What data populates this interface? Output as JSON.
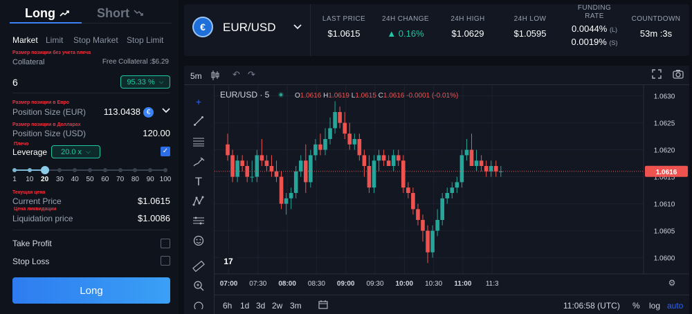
{
  "side_tabs": {
    "long": "Long",
    "short": "Short"
  },
  "order_tabs": [
    "Market",
    "Limit",
    "Stop Market",
    "Stop Limit"
  ],
  "order_tabs_active": 0,
  "collateral": {
    "ru_hint": "Размер позиции без учета плеча",
    "label": "Collateral",
    "free_label": "Free Collateral :$6.29",
    "amount": "6",
    "percent": "95.33 %"
  },
  "position_eur": {
    "ru_hint": "Размер позиции в Евро",
    "label": "Position Size (EUR)",
    "value": "113.0438"
  },
  "position_usd": {
    "ru_hint": "Размер позиции в Долларах",
    "label": "Position Size (USD)",
    "value": "120.00"
  },
  "leverage": {
    "ru_hint": "Плечо",
    "label": "Leverage",
    "value": "20.0 x",
    "checked": true,
    "marks": [
      "1",
      "10",
      "20",
      "30",
      "40",
      "50",
      "60",
      "70",
      "80",
      "90",
      "100"
    ],
    "current_mark_index": 2
  },
  "current_price": {
    "ru_hint": "Текущая цена",
    "label": "Current Price",
    "value": "$1.0615"
  },
  "liquidation": {
    "ru_hint": "Цена ликвидации",
    "label": "Liquidation price",
    "value": "$1.0086"
  },
  "take_profit": {
    "label": "Take Profit"
  },
  "stop_loss": {
    "label": "Stop Loss"
  },
  "submit_label": "Long",
  "market": {
    "pair_base": "EUR",
    "pair_quote": "/USD",
    "stats": [
      {
        "label": "LAST PRICE",
        "value": "$1.0615"
      },
      {
        "label": "24H CHANGE",
        "value": "▲ 0.16%"
      },
      {
        "label": "24H HIGH",
        "value": "$1.0629"
      },
      {
        "label": "24H LOW",
        "value": "$1.0595"
      },
      {
        "label": "FUNDING",
        "label2": "RATE",
        "value": "0.0044%",
        "value_tag": "(L)",
        "value2": "0.0019%",
        "value2_tag": "(S)"
      },
      {
        "label": "COUNTDOWN",
        "value": "53m :3s"
      }
    ]
  },
  "chart_toolbar": {
    "timeframe": "5m"
  },
  "chart_bottom": {
    "ranges": [
      "6h",
      "1d",
      "3d",
      "2w",
      "3m"
    ],
    "clock": "11:06:58 (UTC)",
    "pct": "%",
    "log": "log",
    "auto": "auto"
  },
  "chart_data": {
    "type": "candlestick",
    "symbol": "EUR/USD · 5",
    "legend": {
      "o": "1.0616",
      "h": "1.0619",
      "l": "1.0615",
      "c": "1.0616",
      "change": "-0.0001 (-0.01%)"
    },
    "last_price_label": "1.0616",
    "ylim": [
      1.0597,
      1.0632
    ],
    "y_ticks": [
      "1.0630",
      "1.0625",
      "1.0620",
      "1.0615",
      "1.0610",
      "1.0605",
      "1.0600"
    ],
    "x_ticks": [
      "07:00",
      "07:30",
      "08:00",
      "08:30",
      "09:00",
      "09:30",
      "10:00",
      "10:30",
      "11:00",
      "11:3"
    ],
    "up_color": "#26a69a",
    "down_color": "#ef5350",
    "candles": [
      [
        1.0621,
        1.0623,
        1.0618,
        1.0619
      ],
      [
        1.0619,
        1.062,
        1.0614,
        1.0615
      ],
      [
        1.0615,
        1.0619,
        1.0614,
        1.0618
      ],
      [
        1.0618,
        1.0619,
        1.0616,
        1.0617
      ],
      [
        1.0617,
        1.0618,
        1.0614,
        1.0615
      ],
      [
        1.0615,
        1.0618,
        1.0614,
        1.0615
      ],
      [
        1.0615,
        1.062,
        1.0614,
        1.0619
      ],
      [
        1.0619,
        1.0622,
        1.0617,
        1.0618
      ],
      [
        1.0618,
        1.0619,
        1.0616,
        1.0617
      ],
      [
        1.0617,
        1.0619,
        1.0615,
        1.0616
      ],
      [
        1.0616,
        1.0618,
        1.0614,
        1.0615
      ],
      [
        1.0615,
        1.0616,
        1.0609,
        1.061
      ],
      [
        1.061,
        1.0612,
        1.0608,
        1.0611
      ],
      [
        1.0611,
        1.0613,
        1.0609,
        1.0612
      ],
      [
        1.0612,
        1.0617,
        1.0611,
        1.0616
      ],
      [
        1.0616,
        1.0619,
        1.0615,
        1.0618
      ],
      [
        1.0618,
        1.0621,
        1.0612,
        1.0614
      ],
      [
        1.0614,
        1.062,
        1.0613,
        1.0619
      ],
      [
        1.0619,
        1.0622,
        1.0618,
        1.0621
      ],
      [
        1.0621,
        1.0623,
        1.0619,
        1.062
      ],
      [
        1.062,
        1.0624,
        1.0619,
        1.0622
      ],
      [
        1.0622,
        1.0626,
        1.0621,
        1.0624
      ],
      [
        1.0624,
        1.0629,
        1.0623,
        1.0627
      ],
      [
        1.0627,
        1.0628,
        1.0624,
        1.0625
      ],
      [
        1.0625,
        1.0627,
        1.0622,
        1.0623
      ],
      [
        1.0623,
        1.0625,
        1.062,
        1.0621
      ],
      [
        1.0621,
        1.0623,
        1.062,
        1.0622
      ],
      [
        1.0622,
        1.0623,
        1.0618,
        1.0619
      ],
      [
        1.0619,
        1.062,
        1.0615,
        1.0617
      ],
      [
        1.0617,
        1.0619,
        1.0612,
        1.0613
      ],
      [
        1.0613,
        1.0619,
        1.0612,
        1.0618
      ],
      [
        1.0618,
        1.062,
        1.0616,
        1.0619
      ],
      [
        1.0619,
        1.062,
        1.0617,
        1.0618
      ],
      [
        1.0618,
        1.0619,
        1.0617,
        1.0617
      ],
      [
        1.0617,
        1.062,
        1.0616,
        1.0619
      ],
      [
        1.0619,
        1.062,
        1.0617,
        1.0618
      ],
      [
        1.0618,
        1.0619,
        1.0612,
        1.0613
      ],
      [
        1.0613,
        1.0614,
        1.0611,
        1.0612
      ],
      [
        1.0612,
        1.0613,
        1.0608,
        1.0609
      ],
      [
        1.0609,
        1.061,
        1.0606,
        1.0607
      ],
      [
        1.0607,
        1.0608,
        1.0603,
        1.0605
      ],
      [
        1.0605,
        1.0606,
        1.0599,
        1.0601
      ],
      [
        1.0601,
        1.0606,
        1.06,
        1.0605
      ],
      [
        1.0605,
        1.0609,
        1.0604,
        1.0607
      ],
      [
        1.0607,
        1.0612,
        1.0606,
        1.0611
      ],
      [
        1.0611,
        1.0613,
        1.061,
        1.0612
      ],
      [
        1.0612,
        1.0614,
        1.0611,
        1.0613
      ],
      [
        1.0613,
        1.0615,
        1.0612,
        1.0614
      ],
      [
        1.0614,
        1.062,
        1.0613,
        1.0619
      ],
      [
        1.0619,
        1.0622,
        1.0618,
        1.062
      ],
      [
        1.062,
        1.0623,
        1.0617,
        1.0617
      ],
      [
        1.0617,
        1.062,
        1.0616,
        1.0618
      ],
      [
        1.0618,
        1.0619,
        1.0616,
        1.0617
      ],
      [
        1.0617,
        1.0618,
        1.0615,
        1.0616
      ],
      [
        1.0616,
        1.0618,
        1.0615,
        1.0617
      ],
      [
        1.0617,
        1.0618,
        1.0615,
        1.0616
      ],
      [
        1.0616,
        1.0617,
        1.0615,
        1.0616
      ]
    ]
  }
}
